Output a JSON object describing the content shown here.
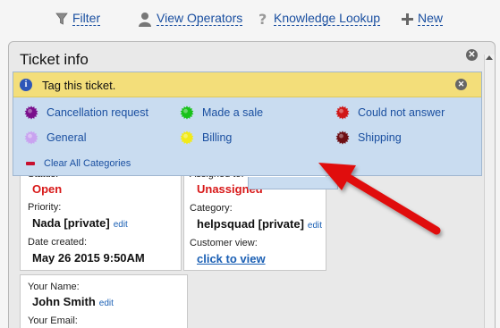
{
  "toolbar": {
    "filter_label": "Filter",
    "view_operators_label": "View Operators",
    "knowledge_lookup_label": "Knowledge Lookup",
    "new_label": "New"
  },
  "window": {
    "title": "Ticket info"
  },
  "popup": {
    "title": "Tag this ticket.",
    "clear_label": "Clear All Categories",
    "categories": [
      {
        "label": "Cancellation request",
        "color": "#7a0f8c"
      },
      {
        "label": "Made a sale",
        "color": "#19c219"
      },
      {
        "label": "Could not answer",
        "color": "#d01717"
      },
      {
        "label": "General",
        "color": "#c9a3f0"
      },
      {
        "label": "Billing",
        "color": "#f2ea17"
      },
      {
        "label": "Shipping",
        "color": "#6e0f14"
      }
    ]
  },
  "ticket": {
    "status_label": "Status:",
    "status_value": "Open",
    "priority_label": "Priority:",
    "priority_value": "Nada [private]",
    "date_label": "Date created:",
    "date_value": "May 26 2015 9:50AM",
    "assigned_label": "Assigned to:",
    "assigned_value": "Unassigned",
    "category_label": "Category:",
    "category_value": "helpsquad [private]",
    "customer_view_label": "Customer view:",
    "customer_view_value": "click to view",
    "edit_label": "edit"
  },
  "contact": {
    "name_label": "Your Name:",
    "name_value": "John Smith",
    "email_label": "Your Email:"
  },
  "colors": {
    "accent": "#1a4fa0",
    "status_red": "#d81818",
    "popup_bg": "#c9dcf0",
    "popup_header_bg": "#f3de7a",
    "arrow": "#e01010"
  }
}
